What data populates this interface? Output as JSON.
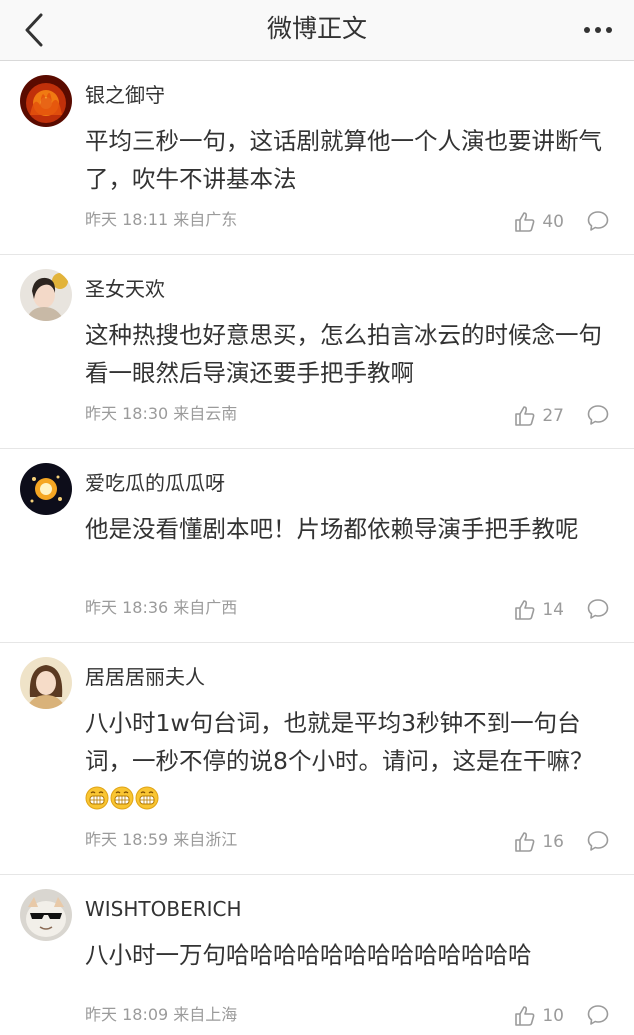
{
  "nav": {
    "title": "微博正文",
    "back_icon": "chevron-left-icon",
    "more_icon": "more-dots-icon"
  },
  "comments": [
    {
      "username": "银之御守",
      "text": "平均三秒一句，这话剧就算他一个人演也要讲断气了，吹牛不讲基本法",
      "time": "昨天 18:11",
      "source": "来自广东",
      "likes": "40",
      "emoji_count": 0
    },
    {
      "username": "圣女天欢",
      "text": "这种热搜也好意思买，怎么拍言冰云的时候念一句看一眼然后导演还要手把手教啊",
      "time": "昨天 18:30",
      "source": "来自云南",
      "likes": "27",
      "emoji_count": 0
    },
    {
      "username": "爱吃瓜的瓜瓜呀",
      "text": "他是没看懂剧本吧！片场都依赖导演手把手教呢",
      "time": "昨天 18:36",
      "source": "来自广西",
      "likes": "14",
      "emoji_count": 0
    },
    {
      "username": "居居居丽夫人",
      "text": "八小时1w句台词，也就是平均3秒钟不到一句台词，一秒不停的说8个小时。请问，这是在干嘛？",
      "time": "昨天 18:59",
      "source": "来自浙江",
      "likes": "16",
      "emoji_count": 3,
      "emoji_icon": "grin-emoji-icon"
    },
    {
      "username": "WISHTOBERICH",
      "text": "八小时一万句哈哈哈哈哈哈哈哈哈哈哈哈哈",
      "time": "昨天 18:09",
      "source": "来自上海",
      "likes": "10",
      "emoji_count": 0
    }
  ],
  "colors": {
    "text_primary": "#333333",
    "text_secondary": "#9b9b9b",
    "divider": "#e6e6e6",
    "navbar_bg": "#f9f9f9"
  }
}
